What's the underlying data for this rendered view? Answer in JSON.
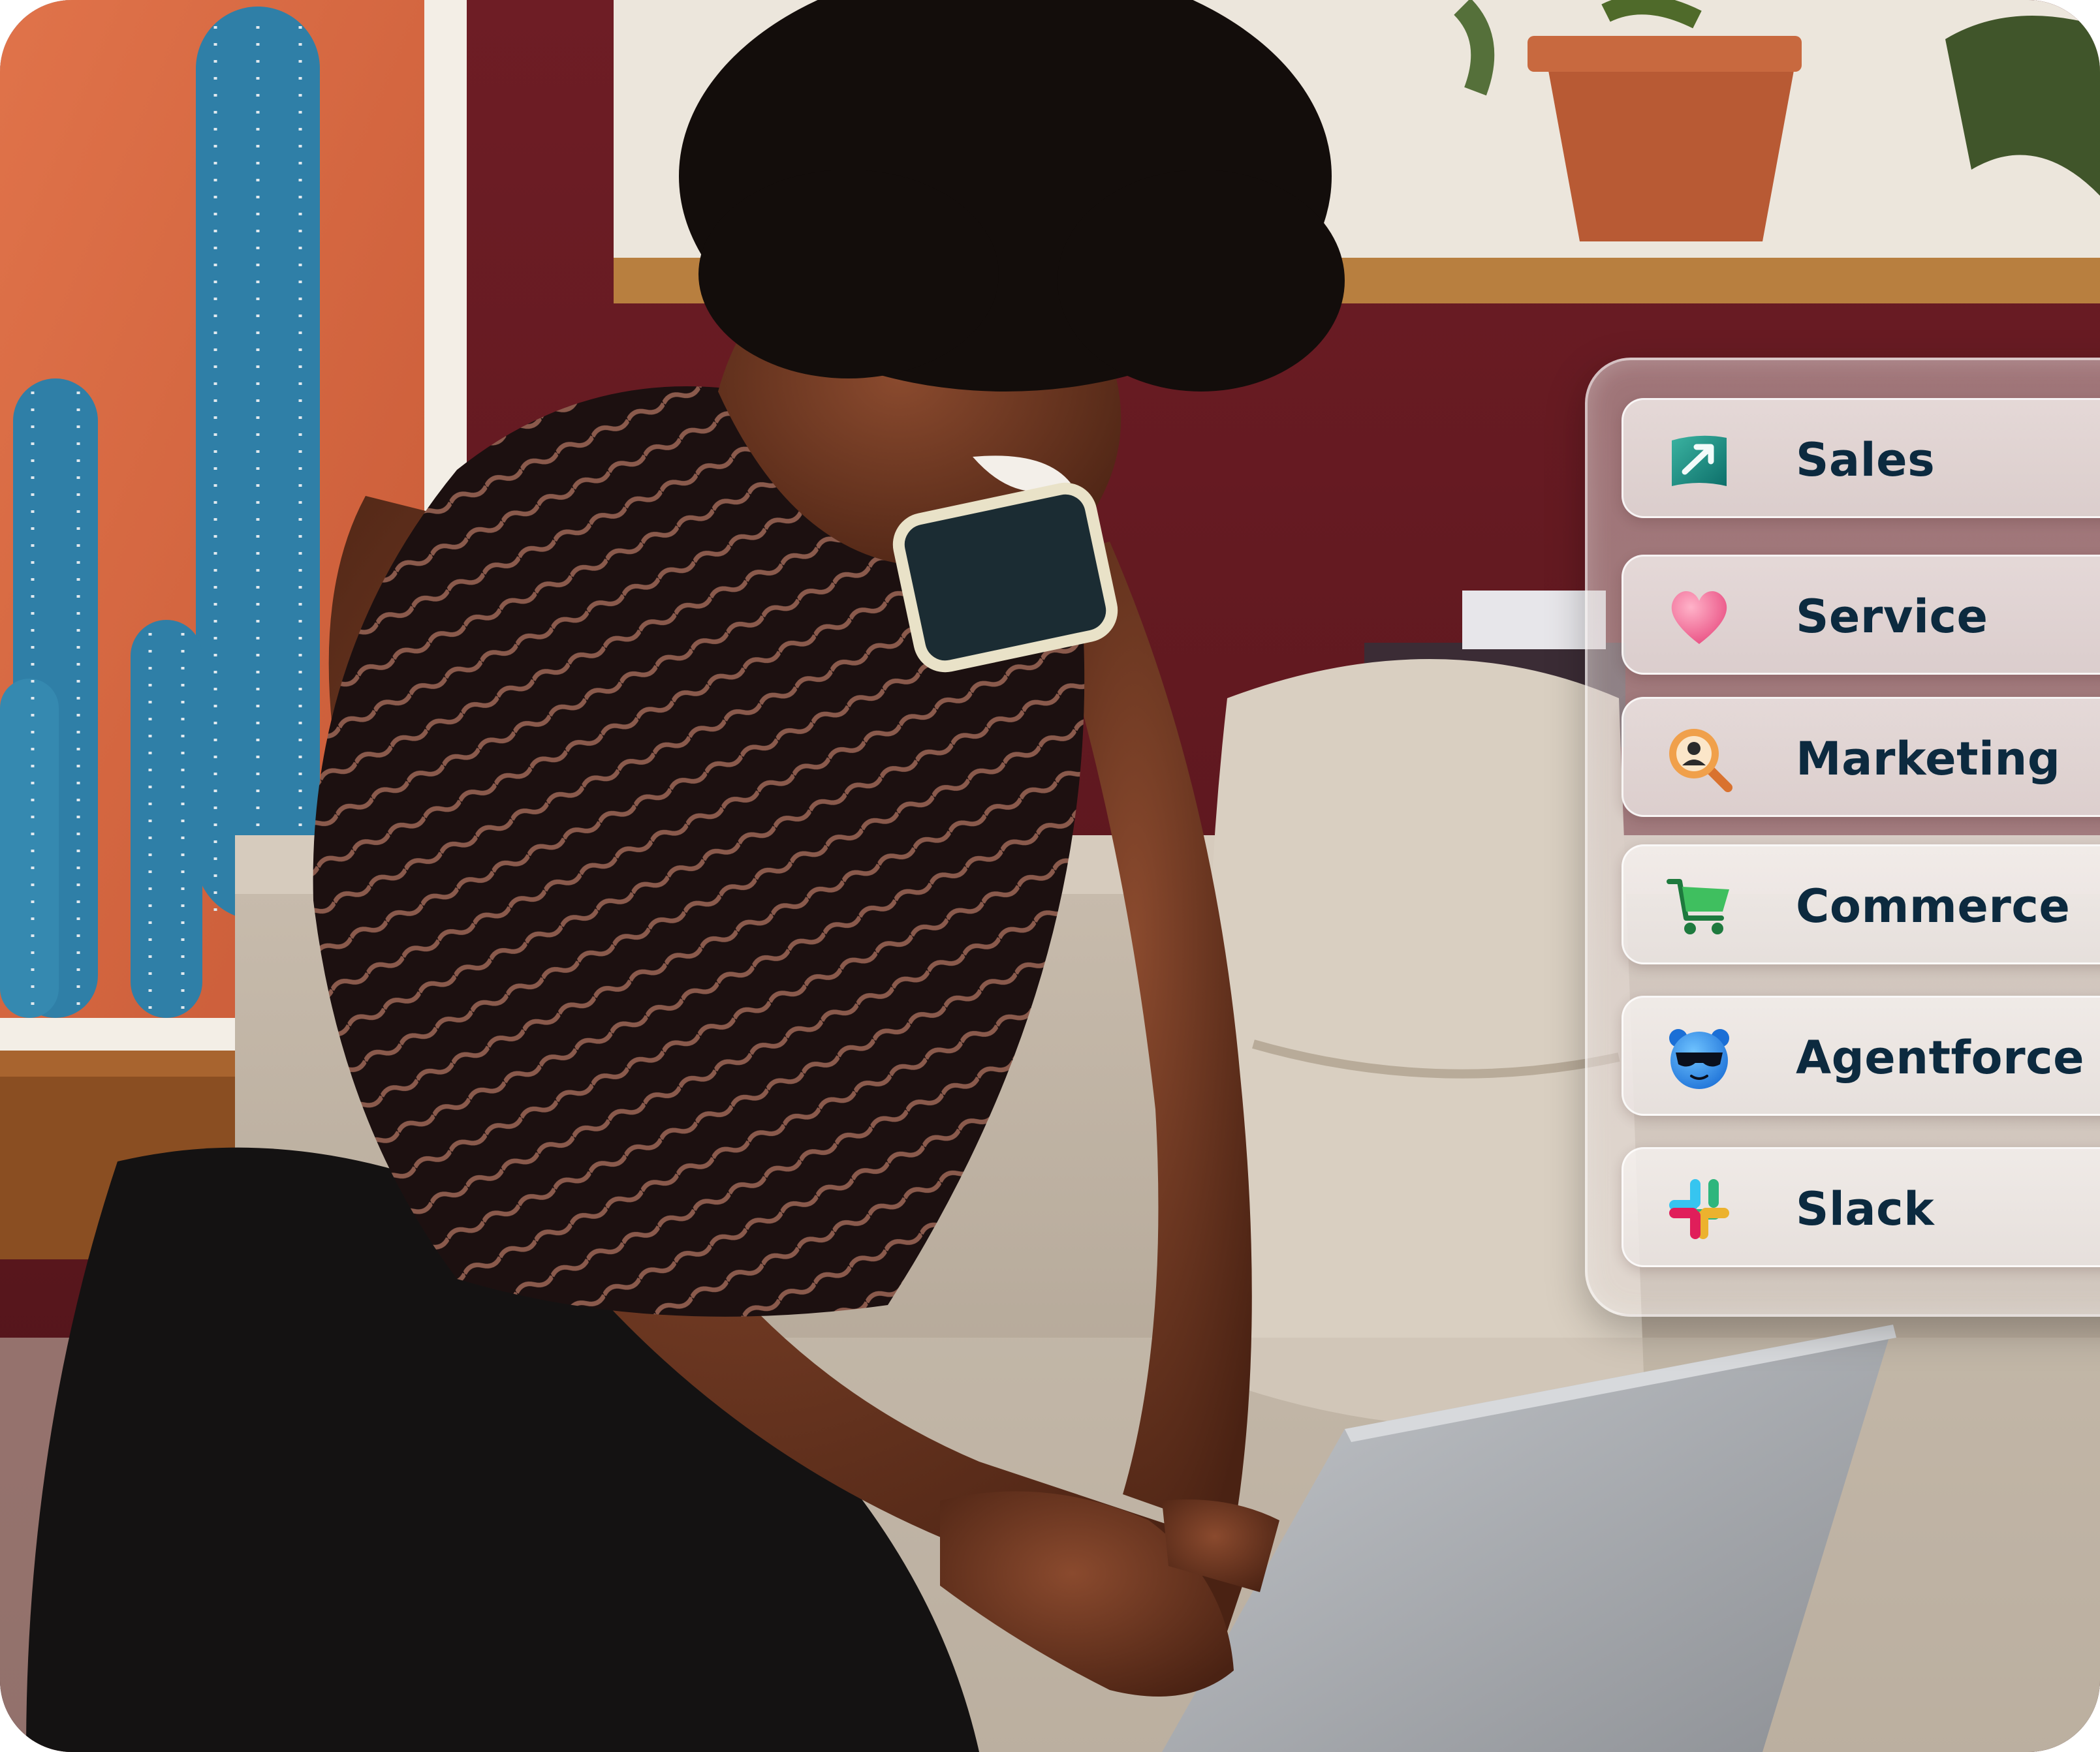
{
  "colors": {
    "label_text": "#0c2a3f",
    "panel_tint": "#d8cccb"
  },
  "menu": {
    "items": [
      {
        "label": "Sales",
        "icon": "sales-chart-arrow-icon"
      },
      {
        "label": "Service",
        "icon": "heart-icon"
      },
      {
        "label": "Marketing",
        "icon": "magnifier-person-icon"
      },
      {
        "label": "Commerce",
        "icon": "shopping-cart-icon"
      },
      {
        "label": "Agentforce",
        "icon": "agent-mascot-icon"
      },
      {
        "label": "Slack",
        "icon": "slack-logo-icon"
      }
    ]
  }
}
